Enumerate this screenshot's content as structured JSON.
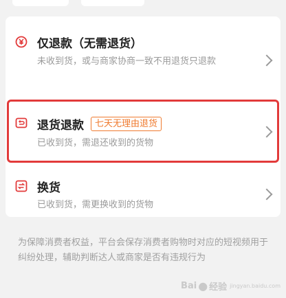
{
  "options": [
    {
      "title": "仅退款（无需退货）",
      "desc": "未收到货，或与商家协商一致不用退货只退款",
      "icon": "refund-coin-icon"
    },
    {
      "title": "退货退款",
      "tag": "七天无理由退货",
      "desc": "已收到货，需退还收到的货物",
      "icon": "return-box-icon"
    },
    {
      "title": "换货",
      "desc": "已收到货，需更换收到的货物",
      "icon": "exchange-icon"
    }
  ],
  "notice": "为保障消费者权益，平台会保存消费者购物时对应的短视频用于纠纷处理，辅助判断达人或商家是否有违规行为",
  "watermark": {
    "brand": "Bai",
    "suffix": "经验",
    "sub": "jingyan.baidu.com"
  },
  "colors": {
    "accent_red": "#e23a3a",
    "tag_orange": "#ef7a2e",
    "title": "#1f1f1f",
    "desc": "#9a9a9a"
  }
}
